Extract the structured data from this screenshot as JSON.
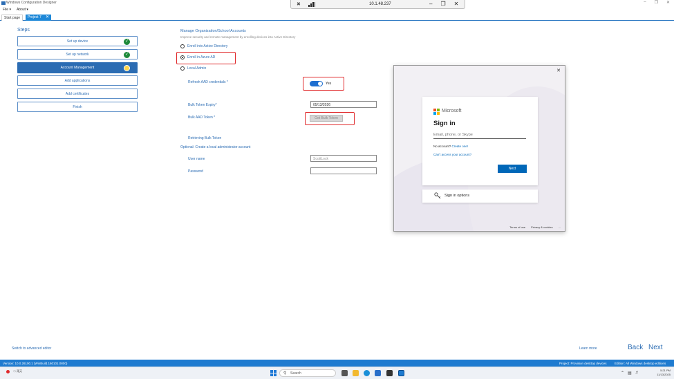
{
  "app": {
    "title": "Windows Configuration Designer",
    "menu": [
      "File ▾",
      "About ▾"
    ],
    "tabs": [
      {
        "label": "Start page"
      },
      {
        "label": "Project 7"
      }
    ]
  },
  "remote_bar": {
    "ip": "10.1.48.237"
  },
  "steps": {
    "heading": "Steps",
    "items": [
      {
        "label": "Set up device"
      },
      {
        "label": "Set up network"
      },
      {
        "label": "Account Management"
      },
      {
        "label": "Add applications"
      },
      {
        "label": "Add certificates"
      },
      {
        "label": "Finish"
      }
    ]
  },
  "form": {
    "title": "Manage Organization/School Accounts",
    "subtitle": "Improve security and remote management by enrolling devices into Active Directory",
    "options": [
      {
        "label": "Enroll into Active Directory",
        "checked": false
      },
      {
        "label": "Enroll in Azure AD",
        "checked": true
      },
      {
        "label": "Local Admin",
        "checked": false
      }
    ],
    "refresh_label": "Refresh AAD credentials *",
    "refresh_value": "Yes",
    "expiry_label": "Bulk Token Expiry*",
    "expiry_value": "05/13/2026",
    "token_label": "Bulk AAD Token *",
    "get_token_button": "Get Bulk Token",
    "retrieving": "Retrieving Bulk Token",
    "optional": "Optional: Create a local administrator account",
    "username_label": "User name",
    "username_value": "ScottLock",
    "password_label": "Password",
    "password_value": ""
  },
  "signin": {
    "brand": "Microsoft",
    "title": "Sign in",
    "email_placeholder": "Email, phone, or Skype",
    "no_account": "No account?",
    "create_one": "Create one!",
    "cant_access": "Can't access your account?",
    "next": "Next",
    "options": "Sign in options",
    "terms": "Terms of use",
    "privacy": "Privacy & cookies",
    "more": "..."
  },
  "footer": {
    "switch_link": "Switch to advanced editor",
    "learn_more": "Learn more",
    "back": "Back",
    "next": "Next"
  },
  "status": {
    "version": "Version: 10.0.26100.1 (WinBuild.160101.0800)",
    "project": "Project: Provision desktop devices",
    "edition": "Edition: All Windows desktop editions"
  },
  "taskbar": {
    "weather": "☁ 雨天",
    "search": "Search",
    "time": "5:21 PM",
    "date": "11/13/2025"
  },
  "colors": {
    "accent": "#2b6cb3",
    "statusbar": "#1e7bd0",
    "highlight_box": "#e0292b",
    "ms_button": "#0067b8"
  }
}
